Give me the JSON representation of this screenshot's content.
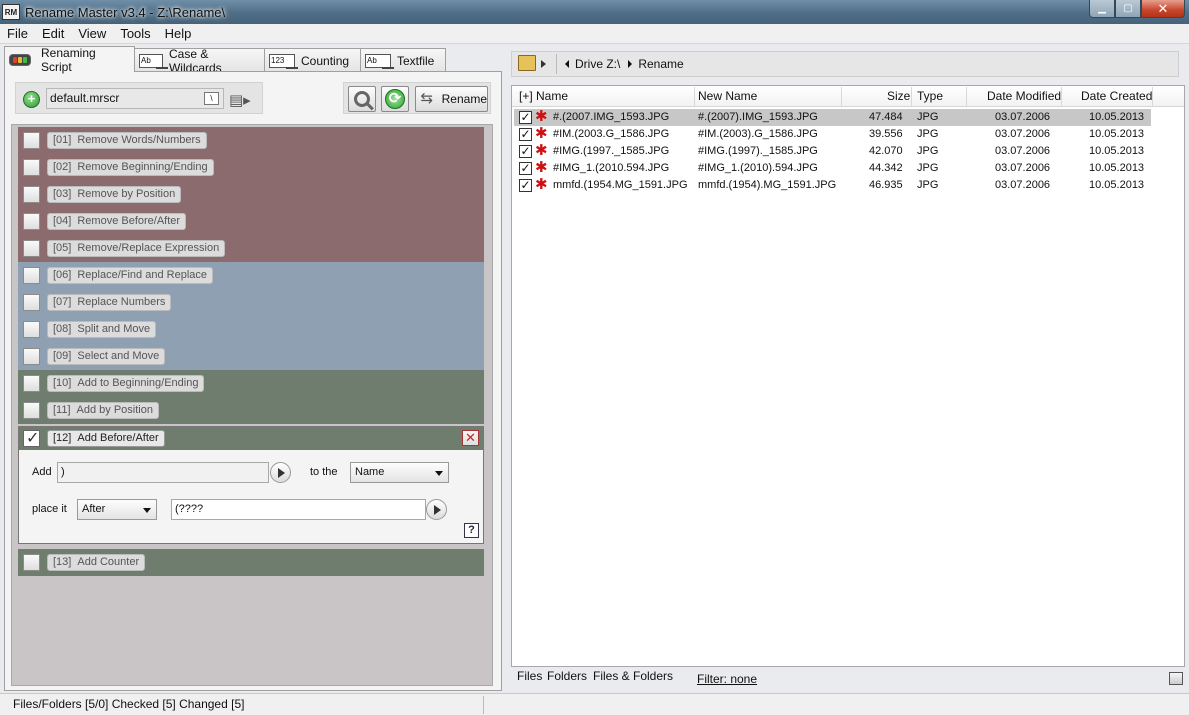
{
  "window": {
    "title": "Rename Master v3.4 - Z:\\Rename\\",
    "icon_text": "RM"
  },
  "menu": [
    "File",
    "Edit",
    "View",
    "Tools",
    "Help"
  ],
  "tabs": [
    {
      "label": "Renaming Script",
      "icon": "traffic-lights-icon",
      "active": true
    },
    {
      "label": "Case & Wildcards",
      "icon": "ab-icon",
      "icon_text": "Ab"
    },
    {
      "label": "Counting",
      "icon": "counter-icon",
      "icon_text": "123"
    },
    {
      "label": "Textfile",
      "icon": "ab-icon",
      "icon_text": "Ab"
    }
  ],
  "script": {
    "file": "default.mrscr"
  },
  "actions": {
    "rename_label": "Rename"
  },
  "modules": [
    {
      "num": "[01]",
      "label": "Remove Words/Numbers",
      "group": "red"
    },
    {
      "num": "[02]",
      "label": "Remove Beginning/Ending",
      "group": "red"
    },
    {
      "num": "[03]",
      "label": "Remove by Position",
      "group": "red"
    },
    {
      "num": "[04]",
      "label": "Remove Before/After",
      "group": "red"
    },
    {
      "num": "[05]",
      "label": "Remove/Replace Expression",
      "group": "red"
    },
    {
      "num": "[06]",
      "label": "Replace/Find and Replace",
      "group": "blue"
    },
    {
      "num": "[07]",
      "label": "Replace Numbers",
      "group": "blue"
    },
    {
      "num": "[08]",
      "label": "Split and Move",
      "group": "blue"
    },
    {
      "num": "[09]",
      "label": "Select and Move",
      "group": "blue"
    },
    {
      "num": "[10]",
      "label": "Add to Beginning/Ending",
      "group": "green"
    },
    {
      "num": "[11]",
      "label": "Add by Position",
      "group": "green"
    }
  ],
  "expanded_module": {
    "num": "[12]",
    "label": "Add Before/After",
    "checked": true,
    "add_label": "Add",
    "add_value": ")",
    "to_the_label": "to the",
    "to_the_value": "Name",
    "place_label": "place it",
    "place_value": "After",
    "pattern_value": "(????",
    "help": "?"
  },
  "module_13": {
    "num": "[13]",
    "label": "Add Counter"
  },
  "nav": {
    "drive": "Drive Z:\\",
    "folder": "Rename"
  },
  "file_columns": {
    "name": "[+] Name",
    "new_name": "New Name",
    "size": "Size",
    "type": "Type",
    "date_modified": "Date Modified",
    "date_created": "Date Created"
  },
  "files": [
    {
      "name": "#.(2007.IMG_1593.JPG",
      "new_name": "#.(2007).IMG_1593.JPG",
      "size": "47.484",
      "type": "JPG",
      "modified": "03.07.2006",
      "created": "10.05.2013",
      "selected": true
    },
    {
      "name": "#IM.(2003.G_1586.JPG",
      "new_name": "#IM.(2003).G_1586.JPG",
      "size": "39.556",
      "type": "JPG",
      "modified": "03.07.2006",
      "created": "10.05.2013"
    },
    {
      "name": "#IMG.(1997._1585.JPG",
      "new_name": "#IMG.(1997)._1585.JPG",
      "size": "42.070",
      "type": "JPG",
      "modified": "03.07.2006",
      "created": "10.05.2013"
    },
    {
      "name": "#IMG_1.(2010.594.JPG",
      "new_name": "#IMG_1.(2010).594.JPG",
      "size": "44.342",
      "type": "JPG",
      "modified": "03.07.2006",
      "created": "10.05.2013"
    },
    {
      "name": "mmfd.(1954.MG_1591.JPG",
      "new_name": "mmfd.(1954).MG_1591.JPG",
      "size": "46.935",
      "type": "JPG",
      "modified": "03.07.2006",
      "created": "10.05.2013"
    }
  ],
  "bottom_tabs": [
    "Files",
    "Folders",
    "Files & Folders"
  ],
  "filter": "Filter:  none",
  "status": "Files/Folders [5/0] Checked [5] Changed [5]",
  "colors": {
    "red_group": "#8c6b6e",
    "blue_group": "#8ea0b2",
    "green_group": "#6f7d6e",
    "selected_row": "#c7c7c7"
  }
}
